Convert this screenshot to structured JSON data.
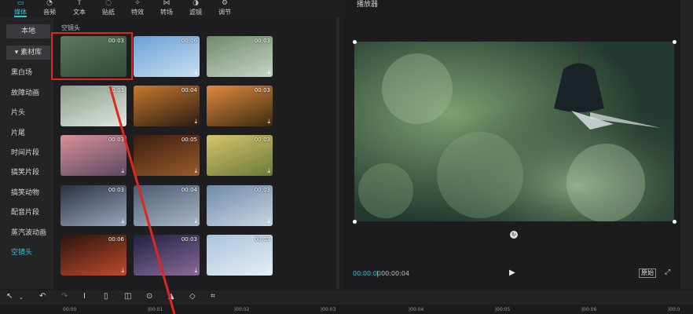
{
  "toolbar": {
    "items": [
      {
        "label": "媒体",
        "icon": "media-icon",
        "active": true
      },
      {
        "label": "音频",
        "icon": "audio-icon"
      },
      {
        "label": "文本",
        "icon": "text-icon"
      },
      {
        "label": "贴纸",
        "icon": "sticker-icon"
      },
      {
        "label": "特效",
        "icon": "effects-icon"
      },
      {
        "label": "转场",
        "icon": "transition-icon"
      },
      {
        "label": "滤镜",
        "icon": "filter-icon"
      },
      {
        "label": "调节",
        "icon": "adjust-icon"
      }
    ]
  },
  "sidebar": {
    "items": [
      {
        "label": "本地"
      },
      {
        "label": "▾ 素材库"
      },
      {
        "label": "黑白场"
      },
      {
        "label": "故障动画"
      },
      {
        "label": "片头"
      },
      {
        "label": "片尾"
      },
      {
        "label": "时间片段"
      },
      {
        "label": "搞笑片段"
      },
      {
        "label": "搞笑动物"
      },
      {
        "label": "配音片段"
      },
      {
        "label": "蒸汽波动画"
      },
      {
        "label": "空镜头"
      }
    ],
    "active": "空镜头"
  },
  "library": {
    "section_title": "空镜头",
    "thumbnails": [
      {
        "duration": "00:03",
        "scene": "wind chime on bokeh green",
        "colors": [
          "#5c7a5e",
          "#2f4a3a"
        ]
      },
      {
        "duration": "00:06",
        "scene": "blue sky with clouds",
        "colors": [
          "#6aa0d6",
          "#c9dff2"
        ]
      },
      {
        "duration": "00:03",
        "scene": "tree branches against sky",
        "colors": [
          "#6d8a6a",
          "#c8d4c7"
        ]
      },
      {
        "duration": "00:03",
        "scene": "branches against bright sky",
        "colors": [
          "#8a9a8a",
          "#dfe6e0"
        ]
      },
      {
        "duration": "00:04",
        "scene": "sunset over city skyline",
        "colors": [
          "#c8782e",
          "#2b1d12"
        ]
      },
      {
        "duration": "00:03",
        "scene": "sun through leaves",
        "colors": [
          "#e28b3c",
          "#3b2a12"
        ]
      },
      {
        "duration": "00:03",
        "scene": "pink sunset over sea",
        "colors": [
          "#d8909a",
          "#5c4860"
        ]
      },
      {
        "duration": "00:05",
        "scene": "dark autumn leaves",
        "colors": [
          "#3a1e10",
          "#9a5a2a"
        ]
      },
      {
        "duration": "00:03",
        "scene": "yellow sunlit leaves",
        "colors": [
          "#d6c46a",
          "#6a7a3a"
        ]
      },
      {
        "duration": "00:03",
        "scene": "city lights aerial",
        "colors": [
          "#2a3040",
          "#9aa6c0"
        ]
      },
      {
        "duration": "00:04",
        "scene": "dense city aerial",
        "colors": [
          "#4a5a70",
          "#aab8c8"
        ]
      },
      {
        "duration": "00:03",
        "scene": "city road with skyscrapers",
        "colors": [
          "#708aa8",
          "#c8d6e4"
        ]
      },
      {
        "duration": "00:06",
        "scene": "night traffic",
        "colors": [
          "#2a1410",
          "#c04a2a"
        ]
      },
      {
        "duration": "00:03",
        "scene": "night city skyline",
        "colors": [
          "#1e2240",
          "#8a6a9a"
        ]
      },
      {
        "duration": "00:03",
        "scene": "airplane at airport",
        "colors": [
          "#a9c4dc",
          "#e6eef5"
        ]
      }
    ]
  },
  "player": {
    "title": "播放器",
    "current_time": "00:00:00",
    "separator": "|",
    "total_time": "00:00:04",
    "ratio_label": "原始",
    "play_icon": "play-icon",
    "fullscreen_icon": "fullscreen-icon",
    "rotate_icon": "rotate-icon"
  },
  "timeline": {
    "toolbar_icons": [
      "select-cursor-icon",
      "undo-icon",
      "redo-icon",
      "split-icon",
      "delete-icon",
      "freeze-icon",
      "play-reverse-icon",
      "mirror-icon",
      "rotate-icon",
      "crop-icon"
    ],
    "ticks": [
      "00:00",
      "|00:01",
      "|00:02",
      "|00:03",
      "|00:04",
      "|00:05",
      "|00:06",
      "|00:0"
    ]
  },
  "accent_color": "#30c6d6",
  "highlight_color": "#e0261e"
}
